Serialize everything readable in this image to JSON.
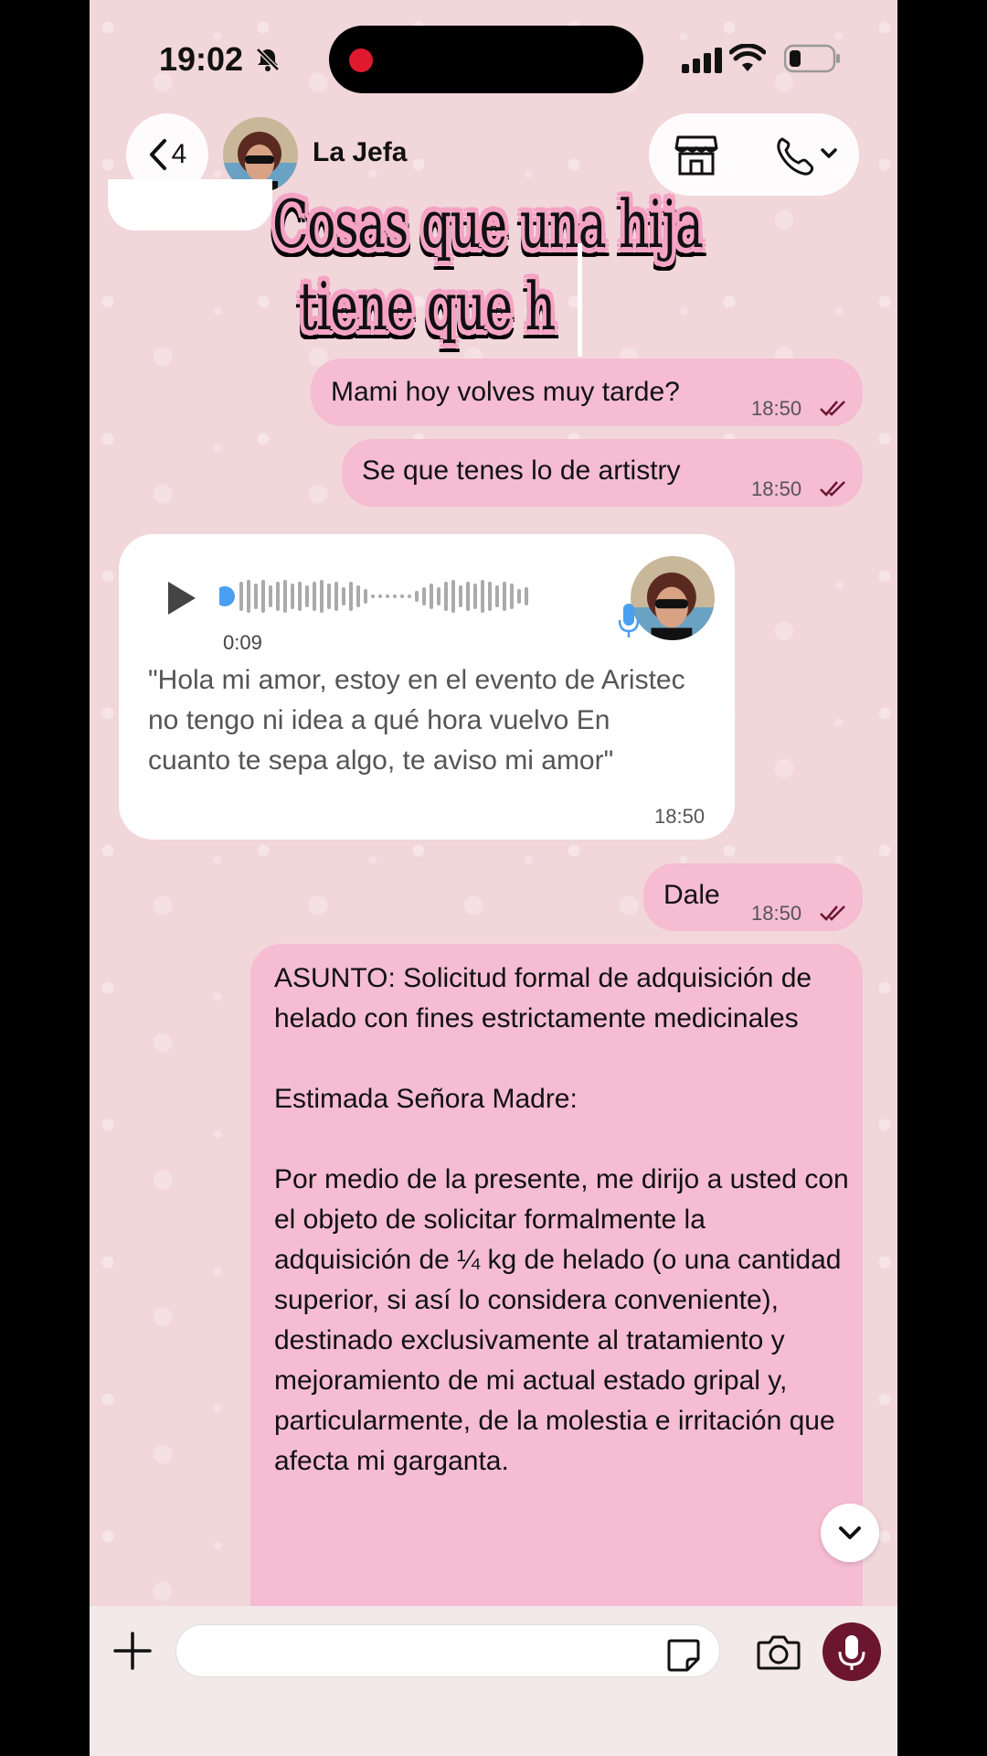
{
  "status_bar": {
    "time": "19:02"
  },
  "header": {
    "back_count": "4",
    "contact_name": "La Jefa"
  },
  "overlay": {
    "line1": "Cosas que una hija",
    "line2": "tiene que h"
  },
  "messages": [
    {
      "text": "Mami hoy volves muy tarde?",
      "time": "18:50"
    },
    {
      "text": "Se que tenes lo de artistry",
      "time": "18:50"
    },
    {
      "text": "Dale",
      "time": "18:50"
    }
  ],
  "voice_note": {
    "duration": "0:09",
    "transcript": "\"Hola mi amor, estoy en el evento de Aristec no tengo ni idea a qué hora vuelvo En cuanto te sepa algo, te aviso mi amor\"",
    "time": "18:50"
  },
  "letter": {
    "text": "ASUNTO: Solicitud formal de adquisición de helado con fines estrictamente medicinales\n\nEstimada Señora Madre:\n\nPor medio de la presente, me dirijo a usted con el objeto de solicitar formalmente la adquisición de ¼ kg de helado (o una cantidad superior, si así lo considera conveniente), destinado exclusivamente al tratamiento y mejoramiento de mi actual estado gripal y, particularmente, de la molestia e irritación que afecta mi garganta."
  },
  "composer": {
    "placeholder": ""
  },
  "colors": {
    "outgoing_bubble": "#f5bcd2",
    "incoming_bubble": "#ffffff",
    "mic_button": "#6b1530",
    "ticks": "#6b1530"
  }
}
